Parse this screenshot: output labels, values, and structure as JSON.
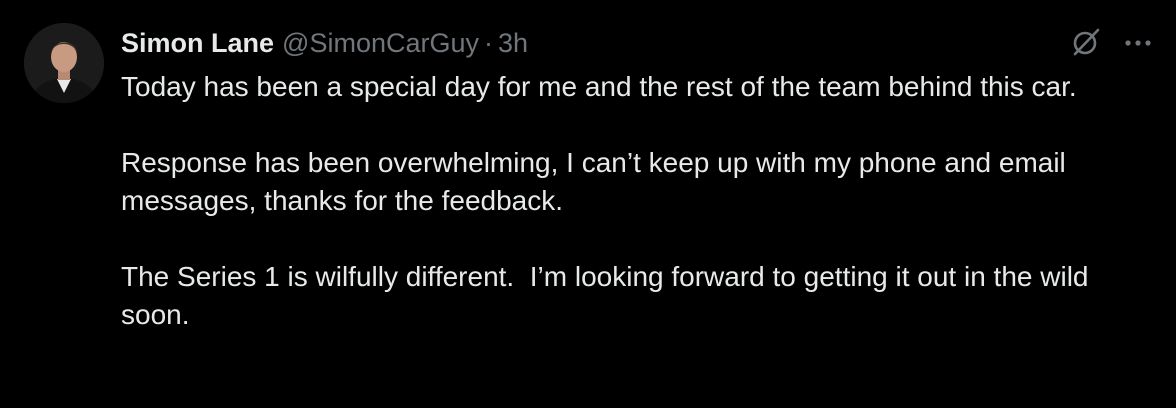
{
  "tweet": {
    "author_name": "Simon Lane",
    "handle": "@SimonCarGuy",
    "separator": "·",
    "time": "3h",
    "paragraphs": [
      "Today has been a special day for me and the rest of the team behind this car.",
      "Response has been overwhelming, I can’t keep up with my phone and email messages, thanks for the feedback.",
      "The Series 1 is wilfully different.  I’m looking forward to getting it out in the wild soon."
    ],
    "icons": {
      "grok": "grok-icon",
      "more": "more-icon",
      "avatar": "avatar"
    },
    "colors": {
      "background": "#000000",
      "text": "#e7e9ea",
      "secondary": "#71767b"
    }
  }
}
